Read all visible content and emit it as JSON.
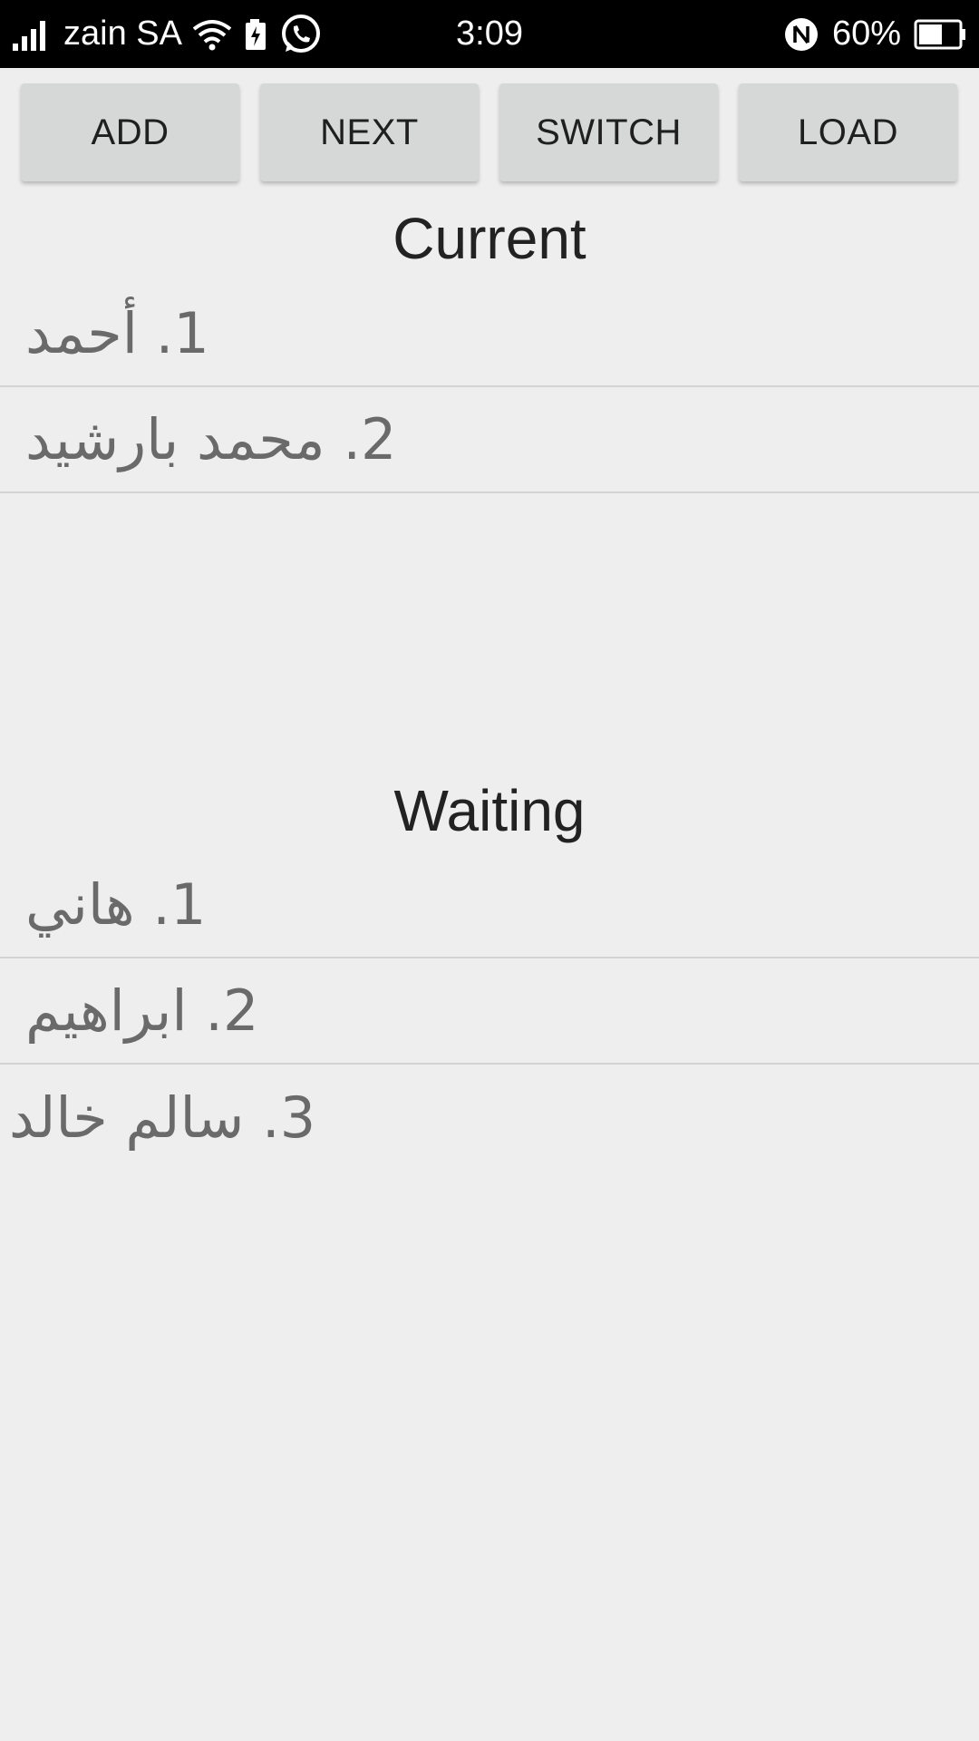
{
  "status_bar": {
    "carrier": "zain SA",
    "time": "3:09",
    "battery": "60%",
    "icons": [
      "signal-icon",
      "wifi-icon",
      "battery-saver-icon",
      "whatsapp-icon",
      "nfc-icon",
      "battery-icon"
    ],
    "battery_level": 0.6
  },
  "toolbar": {
    "add_label": "ADD",
    "next_label": "NEXT",
    "switch_label": "SWITCH",
    "load_label": "LOAD"
  },
  "current": {
    "title": "Current",
    "items": [
      {
        "text": "1. أحمد"
      },
      {
        "text": "2. محمد بارشيد"
      }
    ]
  },
  "waiting": {
    "title": "Waiting",
    "items": [
      {
        "text": "1. هاني"
      },
      {
        "text": "2. ابراهيم"
      },
      {
        "text": "3. سالم خالد"
      }
    ]
  },
  "colors": {
    "status_bar_bg": "#000000",
    "page_bg": "#eeeeee",
    "button_bg": "#d6d7d7",
    "item_text": "#6a6a6a",
    "divider": "#d3d3d3"
  }
}
